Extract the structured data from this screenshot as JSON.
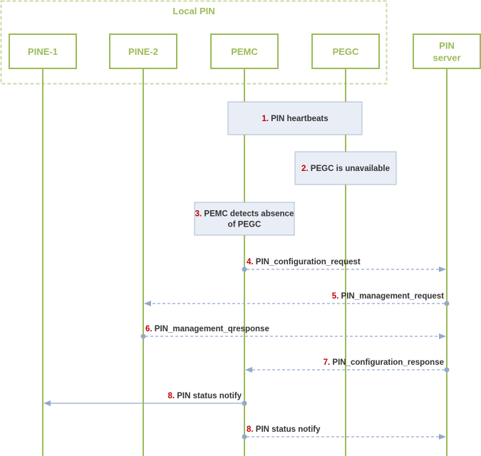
{
  "group": {
    "label": "Local PIN"
  },
  "entities": [
    {
      "id": "pine1",
      "lines": [
        "PINE-1"
      ]
    },
    {
      "id": "pine2",
      "lines": [
        "PINE-2"
      ]
    },
    {
      "id": "pemc",
      "lines": [
        "PEMC"
      ]
    },
    {
      "id": "pegc",
      "lines": [
        "PEGC"
      ]
    },
    {
      "id": "pinserver",
      "lines": [
        "PIN",
        "server"
      ]
    }
  ],
  "notes": [
    {
      "num": "1.",
      "lines": [
        "PIN heartbeats"
      ]
    },
    {
      "num": "2.",
      "lines": [
        "PEGC is unavailable"
      ]
    },
    {
      "num": "3.",
      "lines": [
        "PEMC detects absence",
        "of PEGC"
      ]
    }
  ],
  "messages": [
    {
      "num": "4.",
      "text": "PIN_configuration_request",
      "from": "pemc",
      "to": "pinserver",
      "style": "dashed"
    },
    {
      "num": "5.",
      "text": "PIN_management_request",
      "from": "pinserver",
      "to": "pine2",
      "style": "dashed"
    },
    {
      "num": "6.",
      "text": "PIN_management_qresponse",
      "from": "pine2",
      "to": "pinserver",
      "style": "dashed"
    },
    {
      "num": "7.",
      "text": "PIN_configuration_response",
      "from": "pinserver",
      "to": "pemc",
      "style": "dashed"
    },
    {
      "num": "8.",
      "text": "PIN status notify",
      "from": "pemc",
      "to": "pine1",
      "style": "solid"
    },
    {
      "num": "8.",
      "text": "PIN status notify",
      "from": "pemc",
      "to": "pinserver",
      "style": "dashed"
    }
  ],
  "colors": {
    "entity": "#9bbb59",
    "group_border": "#c9dba6",
    "note_fill": "#e9eef6",
    "note_border": "#a9b9d3",
    "arrow": "#93a9cc",
    "step_number": "#c00000",
    "text": "#333333"
  }
}
